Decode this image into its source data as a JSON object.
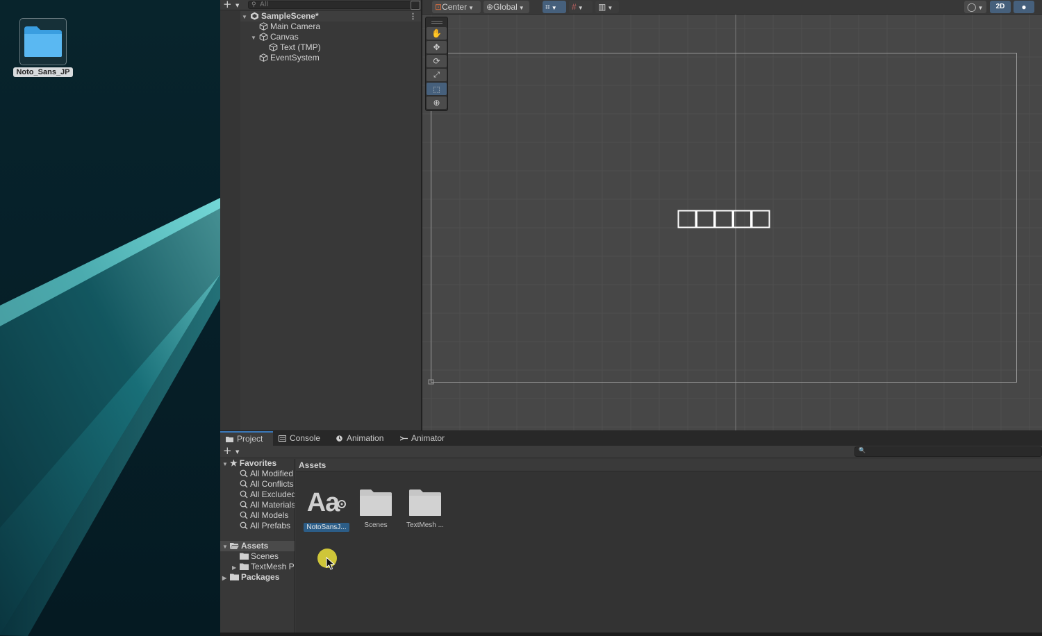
{
  "desktop": {
    "folder_label": "Noto_Sans_JP"
  },
  "hierarchy": {
    "add_label": "+",
    "search_placeholder": "All",
    "scene_name": "SampleScene*",
    "items": [
      {
        "label": "Main Camera"
      },
      {
        "label": "Canvas"
      },
      {
        "label": "Text (TMP)"
      },
      {
        "label": "EventSystem"
      }
    ]
  },
  "scene_toolbar": {
    "pivot_label": "Center",
    "space_label": "Global",
    "mode_2d_label": "2D"
  },
  "scene": {
    "tofu_box_count": 5
  },
  "project": {
    "tabs": [
      {
        "label": "Project"
      },
      {
        "label": "Console"
      },
      {
        "label": "Animation"
      },
      {
        "label": "Animator"
      }
    ],
    "add_label": "+",
    "favorites": {
      "label": "Favorites",
      "items": [
        {
          "label": "All Modified"
        },
        {
          "label": "All Conflicts"
        },
        {
          "label": "All Excluded"
        },
        {
          "label": "All Materials"
        },
        {
          "label": "All Models"
        },
        {
          "label": "All Prefabs"
        }
      ]
    },
    "assets_root": "Assets",
    "asset_folders": [
      {
        "label": "Scenes"
      },
      {
        "label": "TextMesh P"
      }
    ],
    "packages_label": "Packages",
    "breadcrumb": "Assets",
    "assets": [
      {
        "name": "NotoSansJ...",
        "icon_text": "Aa",
        "icon": "font-asset-icon"
      },
      {
        "name": "Scenes",
        "icon": "folder-icon"
      },
      {
        "name": "TextMesh ...",
        "icon": "folder-icon"
      }
    ]
  },
  "colors": {
    "selection_blue": "#2c5d87",
    "toolbar_active": "#46607c",
    "cursor_highlight": "#e0d63a",
    "wallpaper_accent": "#5fd6d8"
  }
}
